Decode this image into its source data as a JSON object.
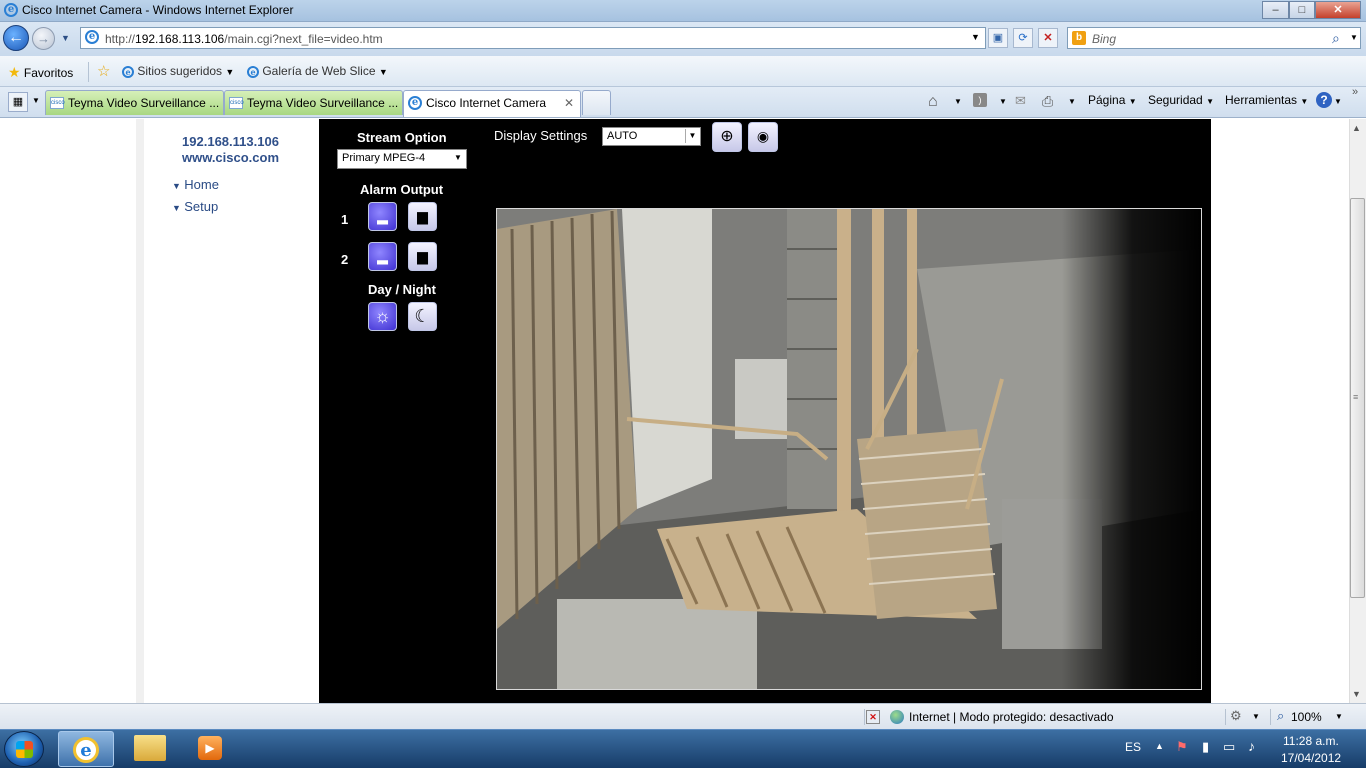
{
  "window": {
    "title": "Cisco Internet Camera - Windows Internet Explorer",
    "minimize": "–",
    "maximize": "□",
    "close": "✕"
  },
  "address_bar": {
    "url_prefix": "http://",
    "url_host": "192.168.113.106",
    "url_path": "/main.cgi?next_file=video.htm",
    "search_placeholder": "Bing"
  },
  "favorites_bar": {
    "favorites": "Favoritos",
    "suggested_sites": "Sitios sugeridos",
    "web_slice_gallery": "Galería de Web Slice"
  },
  "tabs": [
    {
      "label": "Teyma Video Surveillance ...",
      "icon": "cisco-icon"
    },
    {
      "label": "Teyma Video Surveillance ...",
      "icon": "cisco-icon"
    },
    {
      "label": "Cisco Internet Camera",
      "icon": "ie-icon"
    }
  ],
  "command_bar": {
    "page": "Página",
    "safety": "Seguridad",
    "tools": "Herramientas"
  },
  "left_nav": {
    "ip": "192.168.113.106",
    "site": "www.cisco.com",
    "items": [
      "Home",
      "Setup"
    ]
  },
  "camera_controls": {
    "stream_option_label": "Stream Option",
    "stream_option_value": "Primary MPEG-4",
    "alarm_output_label": "Alarm Output",
    "alarm_numbers": [
      "1",
      "2"
    ],
    "day_night_label": "Day / Night",
    "display_settings_label": "Display Settings",
    "display_settings_value": "AUTO"
  },
  "status_bar": {
    "zone": "Internet | Modo protegido: desactivado",
    "zoom": "100%"
  },
  "taskbar": {
    "language": "ES",
    "time": "11:28 a.m.",
    "date": "17/04/2012"
  }
}
